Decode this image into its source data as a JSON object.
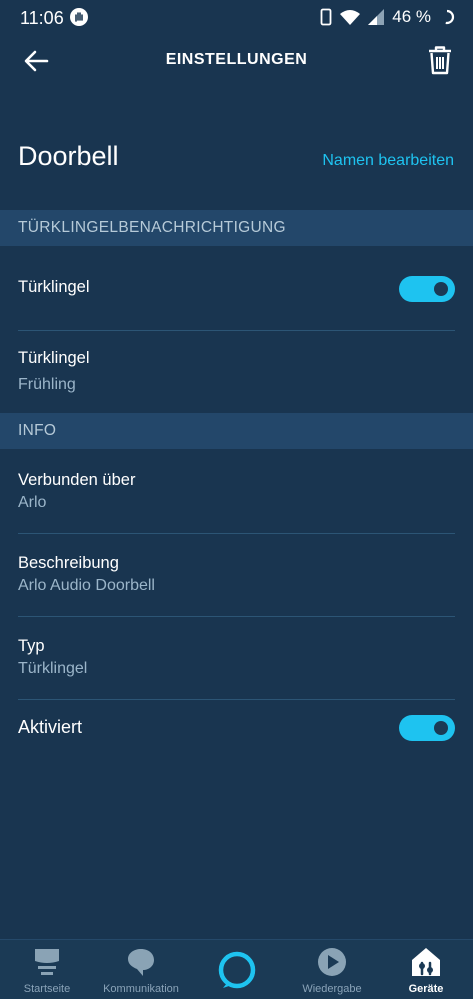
{
  "status_bar": {
    "time": "11:06",
    "battery_text": "46 %"
  },
  "app_bar": {
    "title": "EINSTELLUNGEN"
  },
  "device": {
    "name": "Doorbell",
    "rename_label": "Namen bearbeiten"
  },
  "sections": {
    "notification_header": "TÜRKLINGELBENACHRICHTIGUNG",
    "info_header": "INFO"
  },
  "notification": {
    "toggle_label": "Türklingel",
    "toggle_on": true,
    "sound_title": "Türklingel",
    "sound_value": "Frühling"
  },
  "info": {
    "connected_title": "Verbunden über",
    "connected_value": "Arlo",
    "description_title": "Beschreibung",
    "description_value": "Arlo Audio Doorbell",
    "type_title": "Typ",
    "type_value": "Türklingel",
    "enabled_label": "Aktiviert",
    "enabled_on": true
  },
  "bottom_nav": {
    "items": [
      {
        "label": "Startseite",
        "icon": "home-feed-icon"
      },
      {
        "label": "Kommunikation",
        "icon": "chat-bubble-icon"
      },
      {
        "label": "",
        "icon": "alexa-ring-icon"
      },
      {
        "label": "Wiedergabe",
        "icon": "play-icon"
      },
      {
        "label": "Geräte",
        "icon": "devices-house-icon",
        "active": true
      }
    ]
  },
  "colors": {
    "background": "#193550",
    "section_header": "#23476a",
    "accent": "#1ec3f0",
    "subtext": "#9bb5c9"
  }
}
